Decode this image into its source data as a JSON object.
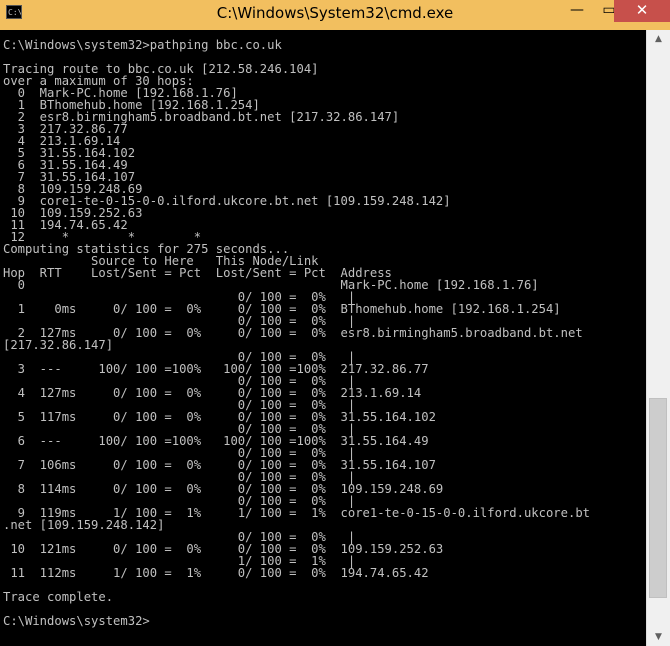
{
  "window": {
    "title": "C:\\Windows\\System32\\cmd.exe",
    "icon_text": "C:\\",
    "minimize": "—",
    "maximize": "▭",
    "close": "✕"
  },
  "scrollbar": {
    "up": "▲",
    "down": "▼"
  },
  "console": {
    "lines": [
      "C:\\Windows\\system32>pathping bbc.co.uk",
      "",
      "Tracing route to bbc.co.uk [212.58.246.104]",
      "over a maximum of 30 hops:",
      "  0  Mark-PC.home [192.168.1.76]",
      "  1  BThomehub.home [192.168.1.254]",
      "  2  esr8.birmingham5.broadband.bt.net [217.32.86.147]",
      "  3  217.32.86.77",
      "  4  213.1.69.14",
      "  5  31.55.164.102",
      "  6  31.55.164.49",
      "  7  31.55.164.107",
      "  8  109.159.248.69",
      "  9  core1-te-0-15-0-0.ilford.ukcore.bt.net [109.159.248.142]",
      " 10  109.159.252.63",
      " 11  194.74.65.42",
      " 12     *        *        *",
      "Computing statistics for 275 seconds...",
      "            Source to Here   This Node/Link",
      "Hop  RTT    Lost/Sent = Pct  Lost/Sent = Pct  Address",
      "  0                                           Mark-PC.home [192.168.1.76]",
      "                                0/ 100 =  0%   |",
      "  1    0ms     0/ 100 =  0%     0/ 100 =  0%  BThomehub.home [192.168.1.254]",
      "                                0/ 100 =  0%   |",
      "  2  127ms     0/ 100 =  0%     0/ 100 =  0%  esr8.birmingham5.broadband.bt.net",
      "[217.32.86.147]",
      "                                0/ 100 =  0%   |",
      "  3  ---     100/ 100 =100%   100/ 100 =100%  217.32.86.77",
      "                                0/ 100 =  0%   |",
      "  4  127ms     0/ 100 =  0%     0/ 100 =  0%  213.1.69.14",
      "                                0/ 100 =  0%   |",
      "  5  117ms     0/ 100 =  0%     0/ 100 =  0%  31.55.164.102",
      "                                0/ 100 =  0%   |",
      "  6  ---     100/ 100 =100%   100/ 100 =100%  31.55.164.49",
      "                                0/ 100 =  0%   |",
      "  7  106ms     0/ 100 =  0%     0/ 100 =  0%  31.55.164.107",
      "                                0/ 100 =  0%   |",
      "  8  114ms     0/ 100 =  0%     0/ 100 =  0%  109.159.248.69",
      "                                0/ 100 =  0%   |",
      "  9  119ms     1/ 100 =  1%     1/ 100 =  1%  core1-te-0-15-0-0.ilford.ukcore.bt",
      ".net [109.159.248.142]",
      "                                0/ 100 =  0%   |",
      " 10  121ms     0/ 100 =  0%     0/ 100 =  0%  109.159.252.63",
      "                                1/ 100 =  1%   |",
      " 11  112ms     1/ 100 =  1%     0/ 100 =  0%  194.74.65.42",
      "",
      "Trace complete.",
      "",
      "C:\\Windows\\system32>"
    ]
  }
}
